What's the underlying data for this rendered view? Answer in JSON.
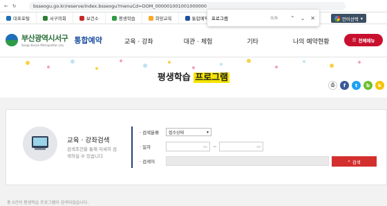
{
  "browser": {
    "url": "bsseogu.go.kr/reserve/index.bsseogu?menuCd=DOM_000001001001000000",
    "find_text": "프로그램",
    "find_count": "0/9",
    "translate_label": "언어선택"
  },
  "bookmarks": [
    {
      "label": "대표포털",
      "color": "#1f6fb7"
    },
    {
      "label": "서구의회",
      "color": "#2e7d32"
    },
    {
      "label": "보건소",
      "color": "#c62828"
    },
    {
      "label": "평생학습",
      "color": "#2e9b46"
    },
    {
      "label": "희망교육",
      "color": "#f9a825"
    },
    {
      "label": "통합예약",
      "color": "#1e4fa0"
    }
  ],
  "header": {
    "logo_main": "부산광역시서구",
    "logo_sub": "Seogu Busan Metropolitan city",
    "logo_title": "통합예약",
    "menu": [
      "교육 · 강좌",
      "대관 · 체험",
      "기타",
      "나의 예약현황"
    ],
    "all_menu": "전체메뉴"
  },
  "banner": {
    "title_plain": "평생학습",
    "title_highlight": "프로그램"
  },
  "sns": [
    {
      "icon": "print-icon",
      "glyph": "⎙",
      "color": "#ffffff"
    },
    {
      "icon": "facebook-icon",
      "glyph": "f",
      "color": "#3b5998"
    },
    {
      "icon": "twitter-icon",
      "glyph": "t",
      "color": "#1da1f2"
    },
    {
      "icon": "blog-icon",
      "glyph": "b",
      "color": "#6cbf2f"
    },
    {
      "icon": "kakao-icon",
      "glyph": "k",
      "color": "#f5c400"
    }
  ],
  "search": {
    "title": "교육 · 강좌검색",
    "desc": "검색조건을 통해 자세히 검색하실 수 있습니다",
    "type_label": "검색분류",
    "type_value": "접수상태",
    "date_label": "일자",
    "date_sep": "~",
    "keyword_label": "검색어",
    "button": "검색"
  },
  "bottom_text": "총 0건의 평생학습 프로그램이 검색되었습니다."
}
